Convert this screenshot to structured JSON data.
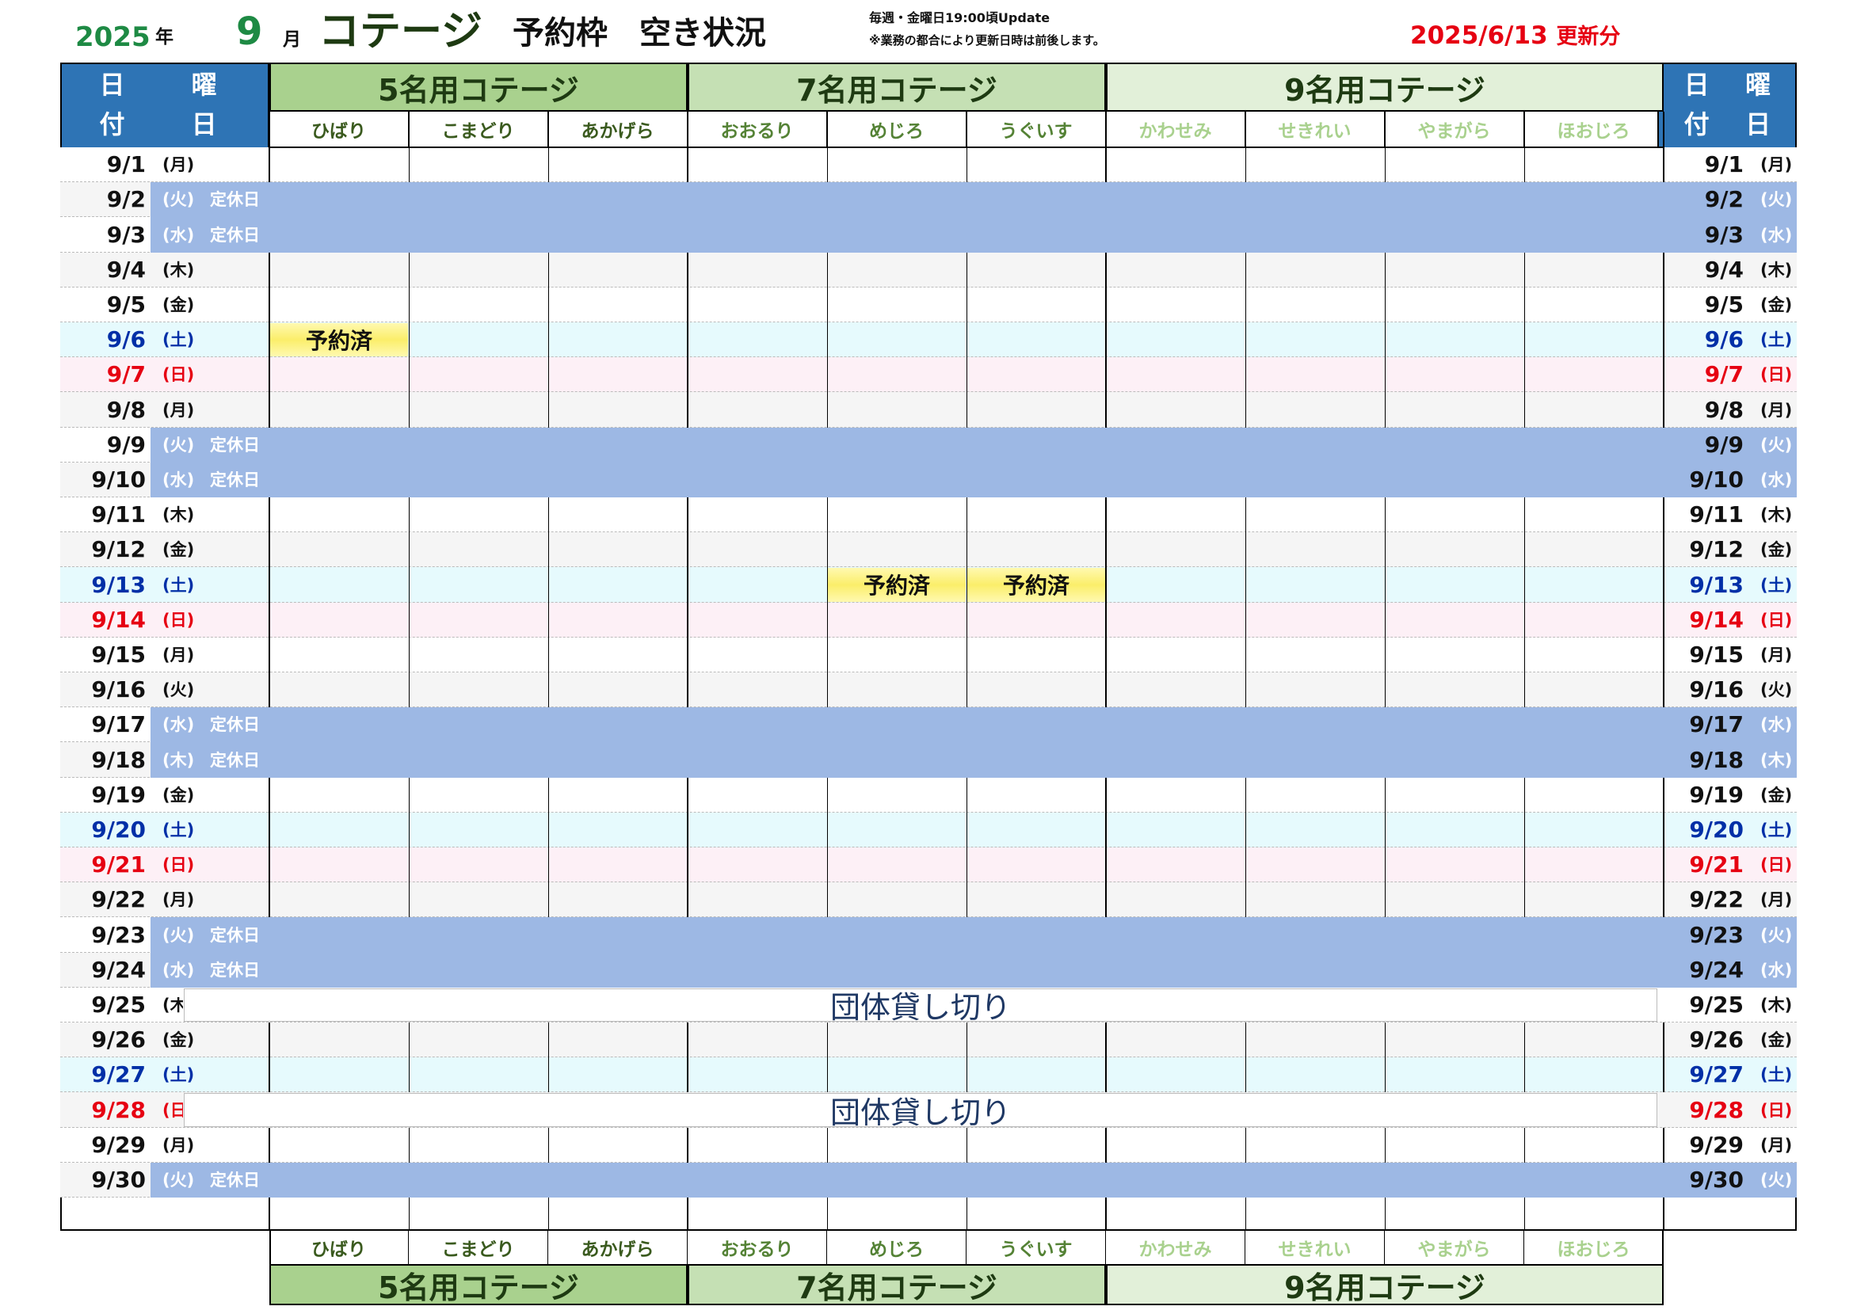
{
  "header": {
    "year": "2025",
    "year_unit": "年",
    "month": "9",
    "month_unit": "月",
    "title": "コテージ",
    "subtitle": "予約枠　空き状況",
    "note_line1": "毎週・金曜日19:00頃Update",
    "note_line2": "※業務の都合により更新日時は前後します。",
    "updated_date": "2025/6/13",
    "updated_suffix": "更新分"
  },
  "date_header": {
    "top_left": "日",
    "top_right": "曜",
    "bottom_left": "付",
    "bottom_right": "日"
  },
  "groups": [
    {
      "name": "5名用コテージ",
      "color": "#a9d18e",
      "text_color": "#1e3a12"
    },
    {
      "name": "7名用コテージ",
      "color": "#c5e0b4",
      "text_color": "#1e3a12"
    },
    {
      "name": "9名用コテージ",
      "color": "#e2f0d9",
      "text_color": "#1e3a12"
    }
  ],
  "columns": [
    {
      "name": "ひばり",
      "color": "#3a5a1e"
    },
    {
      "name": "こまどり",
      "color": "#3a5a1e"
    },
    {
      "name": "あかげら",
      "color": "#3a5a1e"
    },
    {
      "name": "おおるり",
      "color": "#548235"
    },
    {
      "name": "めじろ",
      "color": "#548235"
    },
    {
      "name": "うぐいす",
      "color": "#548235"
    },
    {
      "name": "かわせみ",
      "color": "#a9d18e"
    },
    {
      "name": "せきれい",
      "color": "#a9d18e"
    },
    {
      "name": "やまがら",
      "color": "#a9d18e"
    },
    {
      "name": "ほおじろ",
      "color": "#a9d18e"
    }
  ],
  "closed_label": "定休日",
  "booked_label": "予約済",
  "charter_label": "団体貸し切り",
  "colors": {
    "header_blue": "#2e74b5",
    "closed": "#9db8e4",
    "saturday": "#e6fafd",
    "sunday": "#fdf0f6",
    "alt_row": "#f5f5f5",
    "sat_text": "#002fa7",
    "sun_text": "#e60012"
  },
  "days": [
    {
      "date": "9/1",
      "dow": "(月)",
      "type": "normal"
    },
    {
      "date": "9/2",
      "dow": "(火)",
      "type": "closed"
    },
    {
      "date": "9/3",
      "dow": "(水)",
      "type": "closed"
    },
    {
      "date": "9/4",
      "dow": "(木)",
      "type": "normal"
    },
    {
      "date": "9/5",
      "dow": "(金)",
      "type": "normal"
    },
    {
      "date": "9/6",
      "dow": "(土)",
      "type": "sat",
      "booked": [
        0
      ]
    },
    {
      "date": "9/7",
      "dow": "(日)",
      "type": "sun"
    },
    {
      "date": "9/8",
      "dow": "(月)",
      "type": "normal"
    },
    {
      "date": "9/9",
      "dow": "(火)",
      "type": "closed"
    },
    {
      "date": "9/10",
      "dow": "(水)",
      "type": "closed"
    },
    {
      "date": "9/11",
      "dow": "(木)",
      "type": "normal"
    },
    {
      "date": "9/12",
      "dow": "(金)",
      "type": "normal"
    },
    {
      "date": "9/13",
      "dow": "(土)",
      "type": "sat",
      "booked": [
        4,
        5
      ]
    },
    {
      "date": "9/14",
      "dow": "(日)",
      "type": "sun"
    },
    {
      "date": "9/15",
      "dow": "(月)",
      "type": "normal"
    },
    {
      "date": "9/16",
      "dow": "(火)",
      "type": "normal"
    },
    {
      "date": "9/17",
      "dow": "(水)",
      "type": "closed"
    },
    {
      "date": "9/18",
      "dow": "(木)",
      "type": "closed"
    },
    {
      "date": "9/19",
      "dow": "(金)",
      "type": "normal"
    },
    {
      "date": "9/20",
      "dow": "(土)",
      "type": "sat"
    },
    {
      "date": "9/21",
      "dow": "(日)",
      "type": "sun"
    },
    {
      "date": "9/22",
      "dow": "(月)",
      "type": "normal"
    },
    {
      "date": "9/23",
      "dow": "(火)",
      "type": "closed"
    },
    {
      "date": "9/24",
      "dow": "(水)",
      "type": "closed"
    },
    {
      "date": "9/25",
      "dow": "(木)",
      "type": "charter"
    },
    {
      "date": "9/26",
      "dow": "(金)",
      "type": "normal"
    },
    {
      "date": "9/27",
      "dow": "(土)",
      "type": "sat"
    },
    {
      "date": "9/28",
      "dow": "(日)",
      "type": "charter",
      "date_color": "sun"
    },
    {
      "date": "9/29",
      "dow": "(月)",
      "type": "normal"
    },
    {
      "date": "9/30",
      "dow": "(火)",
      "type": "closed"
    }
  ]
}
